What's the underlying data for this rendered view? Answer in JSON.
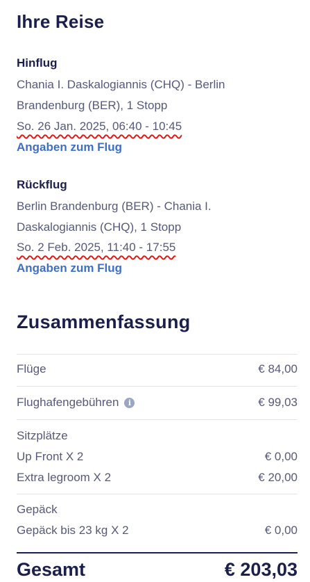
{
  "trip": {
    "title": "Ihre Reise",
    "outbound": {
      "heading": "Hinflug",
      "route_line1": "Chania I. Daskalogiannis (CHQ) - Berlin",
      "route_line2": "Brandenburg (BER), 1 Stopp",
      "datetime": "So. 26 Jan. 2025, 06:40 - 10:45",
      "details_link": "Angaben zum Flug"
    },
    "return": {
      "heading": "Rückflug",
      "route_line1": "Berlin Brandenburg (BER) - Chania I.",
      "route_line2": "Daskalogiannis (CHQ), 1 Stopp",
      "datetime": "So. 2 Feb. 2025, 11:40 - 17:55",
      "details_link": "Angaben zum Flug"
    }
  },
  "summary": {
    "title": "Zusammenfassung",
    "flights": {
      "label": "Flüge",
      "value": "€ 84,00"
    },
    "airport_fees": {
      "label": "Flughafengebühren",
      "value": "€ 99,03",
      "info_icon": "i"
    },
    "seats": {
      "label": "Sitzplätze",
      "items": [
        {
          "label": "Up Front X 2",
          "value": "€ 0,00"
        },
        {
          "label": "Extra legroom X 2",
          "value": "€ 20,00"
        }
      ]
    },
    "baggage": {
      "label": "Gepäck",
      "items": [
        {
          "label": "Gepäck bis 23 kg X 2",
          "value": "€ 0,00"
        }
      ]
    },
    "total": {
      "label": "Gesamt",
      "value": "€ 203,03"
    }
  },
  "colors": {
    "heading": "#1b1f4b",
    "text": "#55597a",
    "link": "#3f6fc4",
    "spellcheck": "#e01818"
  }
}
